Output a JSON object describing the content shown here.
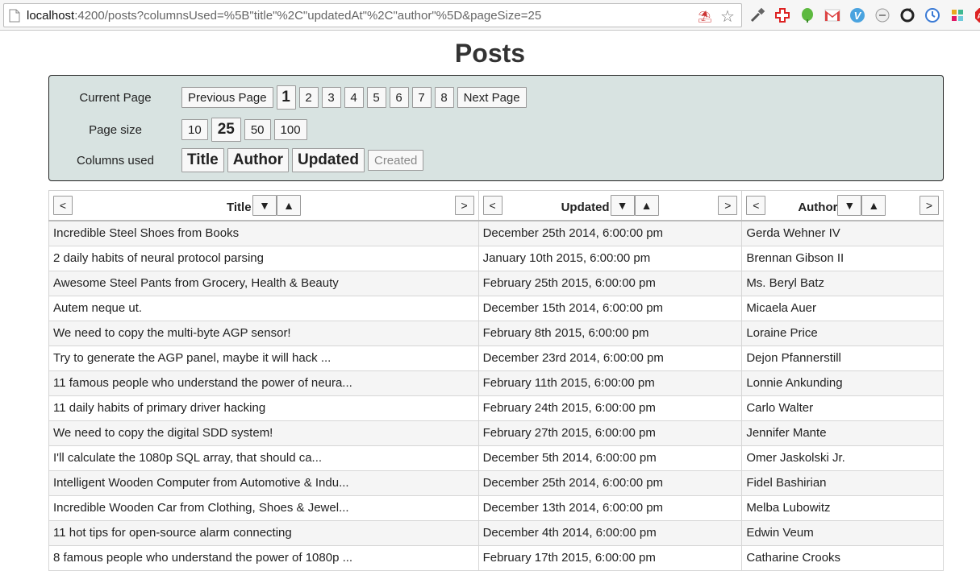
{
  "browser": {
    "url_host": "localhost",
    "url_rest": ":4200/posts?columnsUsed=%5B\"title\"%2C\"updatedAt\"%2C\"author\"%5D&pageSize=25"
  },
  "page_title": "Posts",
  "controls": {
    "current_page_label": "Current Page",
    "previous_label": "Previous Page",
    "next_label": "Next Page",
    "pages": [
      "1",
      "2",
      "3",
      "4",
      "5",
      "6",
      "7",
      "8"
    ],
    "active_page": "1",
    "page_size_label": "Page size",
    "page_sizes": [
      "10",
      "25",
      "50",
      "100"
    ],
    "active_page_size": "25",
    "columns_label": "Columns used",
    "columns": [
      {
        "label": "Title",
        "active": true
      },
      {
        "label": "Author",
        "active": true
      },
      {
        "label": "Updated",
        "active": true
      },
      {
        "label": "Created",
        "active": false
      }
    ]
  },
  "table": {
    "left_arrow": "<",
    "right_arrow": ">",
    "sort_desc": "▼",
    "sort_asc": "▲",
    "headers": [
      "Title",
      "Updated",
      "Author"
    ],
    "rows": [
      [
        "Incredible Steel Shoes from Books",
        "December 25th 2014, 6:00:00 pm",
        "Gerda Wehner IV"
      ],
      [
        "2 daily habits of neural protocol parsing",
        "January 10th 2015, 6:00:00 pm",
        "Brennan Gibson II"
      ],
      [
        "Awesome Steel Pants from Grocery, Health & Beauty",
        "February 25th 2015, 6:00:00 pm",
        "Ms. Beryl Batz"
      ],
      [
        "Autem neque ut.",
        "December 15th 2014, 6:00:00 pm",
        "Micaela Auer"
      ],
      [
        "We need to copy the multi-byte AGP sensor!",
        "February 8th 2015, 6:00:00 pm",
        "Loraine Price"
      ],
      [
        "Try to generate the AGP panel, maybe it will hack ...",
        "December 23rd 2014, 6:00:00 pm",
        "Dejon Pfannerstill"
      ],
      [
        "11 famous people who understand the power of neura...",
        "February 11th 2015, 6:00:00 pm",
        "Lonnie Ankunding"
      ],
      [
        "11 daily habits of primary driver hacking",
        "February 24th 2015, 6:00:00 pm",
        "Carlo Walter"
      ],
      [
        "We need to copy the digital SDD system!",
        "February 27th 2015, 6:00:00 pm",
        "Jennifer Mante"
      ],
      [
        "I'll calculate the 1080p SQL array, that should ca...",
        "December 5th 2014, 6:00:00 pm",
        "Omer Jaskolski Jr."
      ],
      [
        "Intelligent Wooden Computer from Automotive & Indu...",
        "December 25th 2014, 6:00:00 pm",
        "Fidel Bashirian"
      ],
      [
        "Incredible Wooden Car from Clothing, Shoes & Jewel...",
        "December 13th 2014, 6:00:00 pm",
        "Melba Lubowitz"
      ],
      [
        "11 hot tips for open-source alarm connecting",
        "December 4th 2014, 6:00:00 pm",
        "Edwin Veum"
      ],
      [
        "8 famous people who understand the power of 1080p ...",
        "February 17th 2015, 6:00:00 pm",
        "Catharine Crooks"
      ]
    ]
  },
  "icons": {
    "page": "document-icon",
    "star": "star-icon",
    "extensions": [
      "eyedropper-icon",
      "red-cross-icon",
      "evernote-icon",
      "gmail-icon",
      "vimeo-icon",
      "minus-circle-icon",
      "sync-icon",
      "clock-icon",
      "slack-icon",
      "adblock-icon"
    ]
  }
}
